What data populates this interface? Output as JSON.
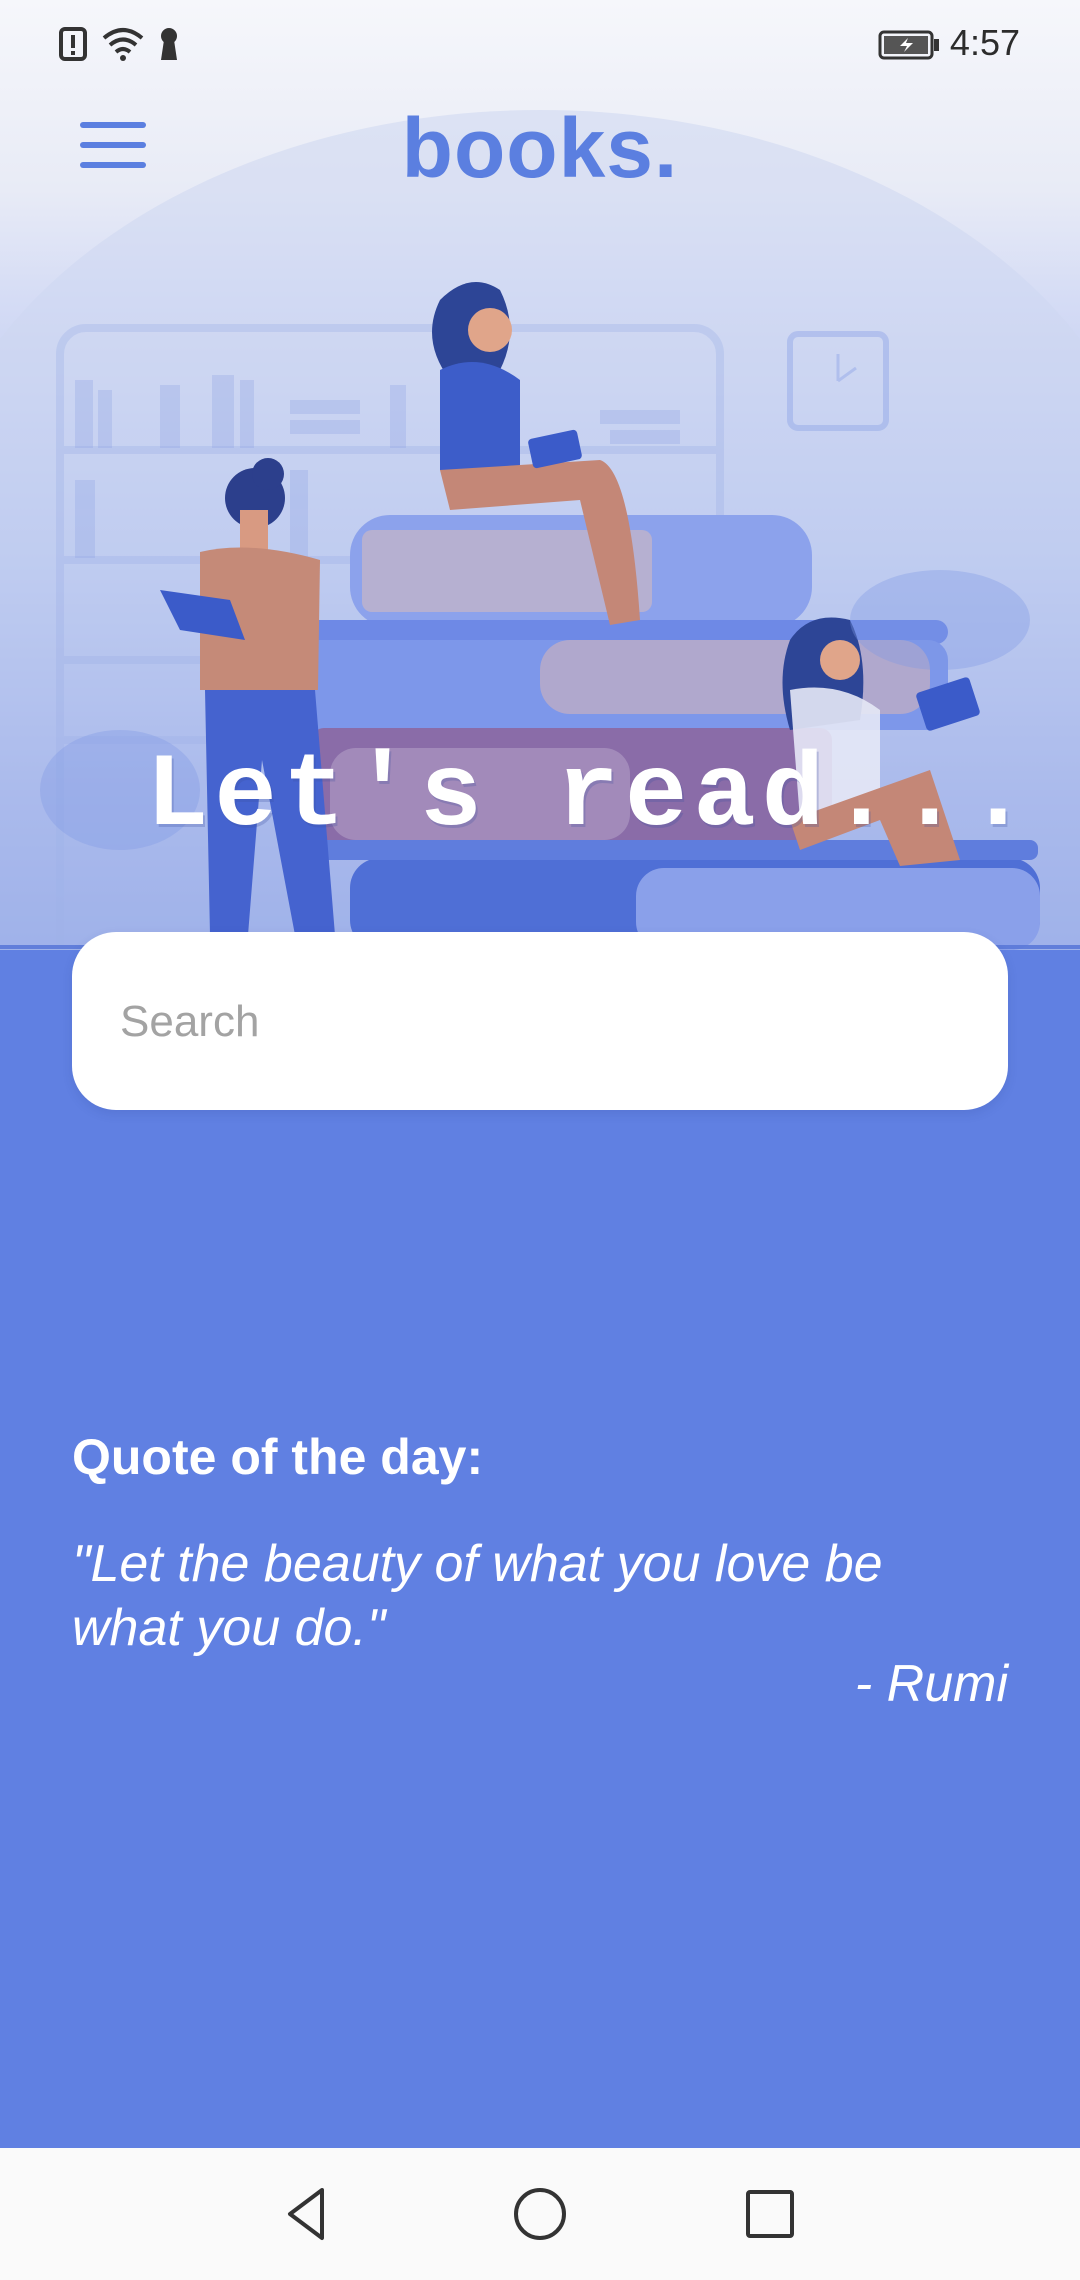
{
  "status_bar": {
    "time": "4:57",
    "icons": [
      "alert-icon",
      "wifi-icon",
      "keyhole-icon",
      "battery-charging-icon"
    ]
  },
  "header": {
    "brand": "books.",
    "menu_icon": "hamburger-menu-icon"
  },
  "hero": {
    "headline": "Let's read...",
    "illustration": "people-reading-books-illustration"
  },
  "search": {
    "placeholder": "Search",
    "value": ""
  },
  "quote": {
    "title": "Quote of the day:",
    "text": "\"Let the beauty of what you love be what you do.\"",
    "author": "- Rumi"
  },
  "nav_bar": {
    "buttons": [
      "back-icon",
      "home-icon",
      "recents-icon"
    ]
  },
  "colors": {
    "accent": "#5b7fe0",
    "background": "#6080e2",
    "card": "#ffffff"
  }
}
